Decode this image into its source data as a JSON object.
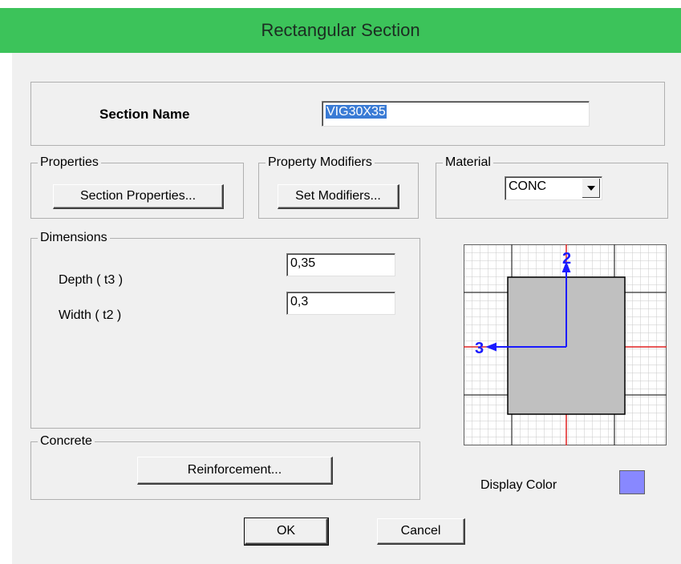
{
  "window": {
    "title": "Rectangular Section"
  },
  "section_name": {
    "label": "Section Name",
    "value": "VIG30X35"
  },
  "properties": {
    "legend": "Properties",
    "button": "Section Properties..."
  },
  "modifiers": {
    "legend": "Property Modifiers",
    "button": "Set Modifiers..."
  },
  "material": {
    "legend": "Material",
    "selected": "CONC"
  },
  "dimensions": {
    "legend": "Dimensions",
    "depth_label": "Depth  ( t3 )",
    "depth_value": "0,35",
    "width_label": "Width  ( t2 )",
    "width_value": "0,3"
  },
  "concrete": {
    "legend": "Concrete",
    "button": "Reinforcement..."
  },
  "preview": {
    "axis2": "2",
    "axis3": "3"
  },
  "display_color": {
    "label": "Display Color",
    "color": "#8888ff"
  },
  "buttons": {
    "ok": "OK",
    "cancel": "Cancel"
  }
}
